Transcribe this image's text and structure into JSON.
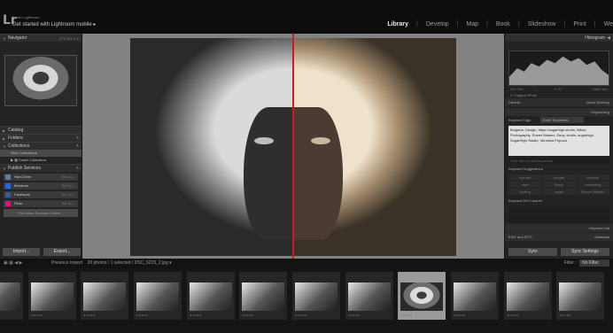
{
  "app": {
    "brand_small": "Adobe Lightroom",
    "brand_main": "Get started with Lightroom mobile ▸",
    "logo_glyph": "Lr",
    "modules": [
      "Library",
      "Develop",
      "Map",
      "Book",
      "Slideshow",
      "Print",
      "We"
    ],
    "active_module": "Library"
  },
  "left_panel": {
    "navigator": {
      "title": "Navigator",
      "zoom_options": "FIT FILL 1:1"
    },
    "sections": [
      "Catalog",
      "Folders",
      "Collections"
    ],
    "collections": [
      {
        "label": "Filter Collections",
        "selected": true
      },
      {
        "label": "Smart Collections",
        "selected": false
      }
    ],
    "publish_title": "Publish Services",
    "publish_items": [
      {
        "label": "Hard Drive",
        "count": "Set Up...",
        "color": "#5a7fa8"
      },
      {
        "label": "Behance",
        "count": "Set Up...",
        "color": "#1769ff"
      },
      {
        "label": "Facebook",
        "count": "Set Up...",
        "color": "#3b5998"
      },
      {
        "label": "Flickr",
        "count": "Set Up...",
        "color": "#ff0084"
      }
    ],
    "find_more": "Find More Services Online...",
    "import_label": "Import...",
    "export_label": "Export..."
  },
  "right_panel": {
    "histogram": {
      "title": "Histogram",
      "iso": "ISO 200",
      "focal": "--",
      "aperture": "f / 8",
      "shutter": "1/640 sec"
    },
    "original_photo": "Original Photo",
    "quick_develop": {
      "title": "Quick Develop",
      "preset": "Default"
    },
    "keywording": {
      "title": "Keywording",
      "keyword_tags_label": "Keyword Tags",
      "keyword_tags_mode": "Enter Keywords",
      "keywords_text": "Bulgaria, Design, https://sugarhigh.studio, Nikon, Photography, Rosen Mateev, Sony, studio, sugarhigh, SugarHigh Studio, Veronica Popova",
      "add_hint": "Click here to add keywords",
      "suggestions_title": "Keyword Suggestions",
      "suggestions": [
        "woman",
        "people",
        "carnival",
        "man",
        "living",
        "competing",
        "surfing",
        "sugar",
        "Rosen Mateev"
      ],
      "set_label": "Keyword Set",
      "set_value": "Custom"
    },
    "keyword_list": "Keyword List",
    "metadata": {
      "title": "Metadata",
      "preset": "EXIF and IPTC"
    },
    "sync_label": "Sync",
    "sync_settings_label": "Sync Settings"
  },
  "filmstrip": {
    "source_label": "Previous Import",
    "summary": "20 photos / 1 selected / DSC_6215_2.jpg ▾",
    "filter_label": "Filter :",
    "filter_value": "No Filter",
    "selected_index": 8,
    "thumb_count": 12,
    "stars": "★★★★★"
  }
}
